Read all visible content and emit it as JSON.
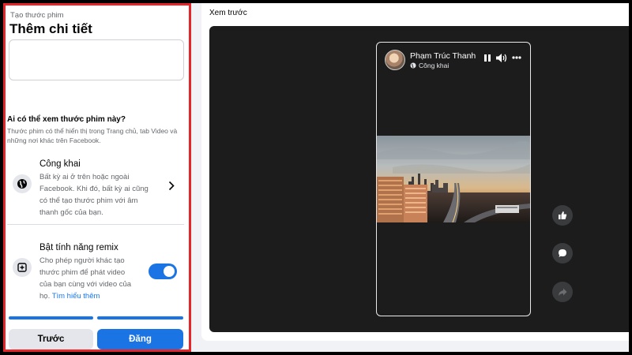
{
  "left_panel": {
    "breadcrumb": "Tạo thước phim",
    "title": "Thêm chi tiết",
    "audience": {
      "heading": "Ai có thể xem thước phim này?",
      "subtitle": "Thước phim có thể hiển thị trong Trang chủ, tab Video và những nơi khác trên Facebook.",
      "option_title": "Công khai",
      "option_desc": "Bất kỳ ai ở trên hoặc ngoài Facebook. Khi đó, bất kỳ ai cũng có thể tạo thước phim với âm thanh gốc của bạn."
    },
    "remix": {
      "title": "Bật tính năng remix",
      "desc": "Cho phép người khác tạo thước phim để phát video của bạn cùng với video của họ.",
      "learn_more": "Tìm hiểu thêm",
      "enabled": true
    },
    "progress": {
      "steps": 2,
      "completed": 2
    },
    "buttons": {
      "prev": "Trước",
      "post": "Đăng"
    }
  },
  "preview": {
    "label": "Xem trước",
    "author": "Phạm Trúc Thanh",
    "privacy": "Công khai"
  },
  "colors": {
    "accent": "#1b74e4",
    "highlight_border": "#e4262b"
  },
  "icons": [
    "globe-icon",
    "chevron-right-icon",
    "remix-icon",
    "pause-icon",
    "volume-icon",
    "more-icon",
    "like-icon",
    "comment-icon",
    "share-icon"
  ]
}
